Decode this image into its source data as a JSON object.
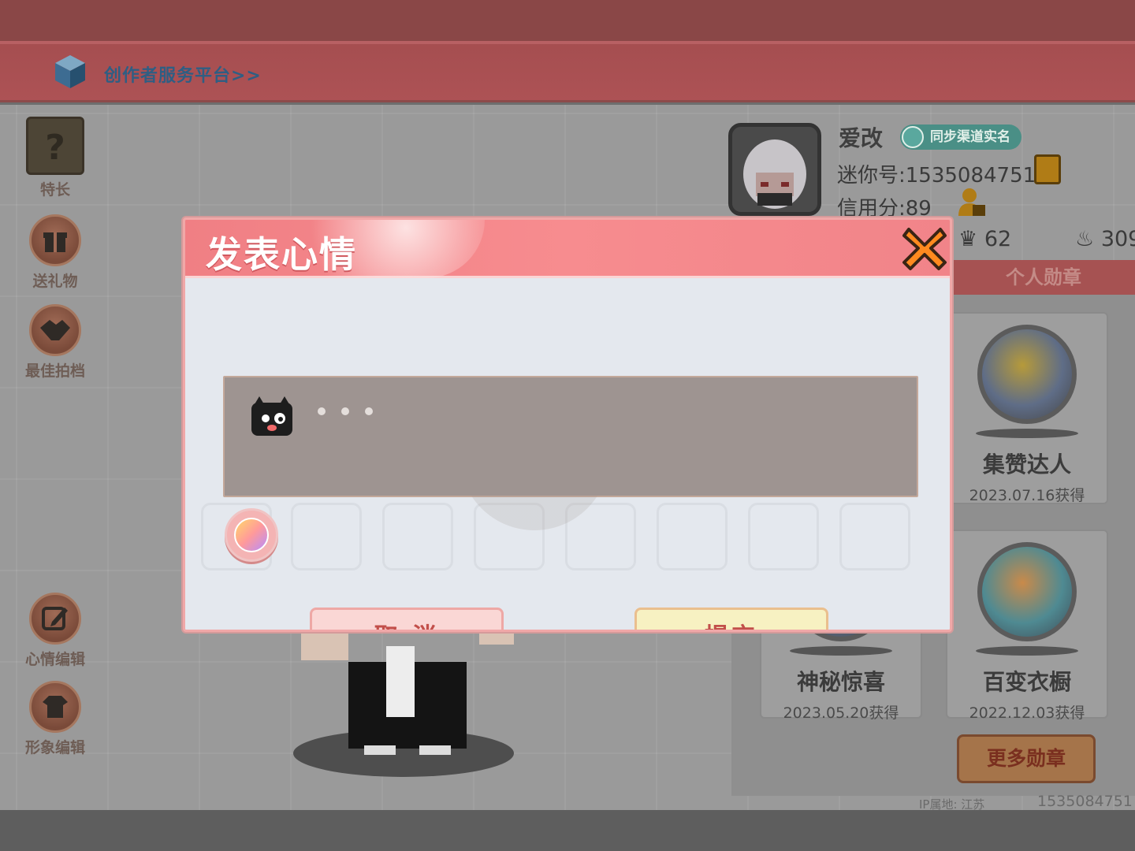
{
  "topbar": {
    "creator_link": "创作者服务平台>>"
  },
  "sidebar": {
    "items": [
      {
        "label": "特长",
        "icon": "question-block-icon"
      },
      {
        "label": "送礼物",
        "icon": "gift-icon"
      },
      {
        "label": "最佳拍档",
        "icon": "handshake-icon"
      },
      {
        "label": "心情编辑",
        "icon": "edit-icon"
      },
      {
        "label": "形象编辑",
        "icon": "outfit-icon"
      }
    ]
  },
  "profile": {
    "name": "爱改",
    "realname_badge": "同步渠道实名",
    "mini_id": "迷你号:1535084751",
    "credit": "信用分:89",
    "likes": "62",
    "hot": "309"
  },
  "medals": {
    "header": "个人勋章",
    "items": [
      {
        "name": "集赞达人",
        "date": "2023.07.16获得"
      },
      {
        "name": "神秘惊喜",
        "date": "2023.05.20获得"
      },
      {
        "name": "百变衣橱",
        "date": "2022.12.03获得"
      }
    ],
    "more_button": "更多勋章"
  },
  "footer": {
    "ip_location": "IP属地: 江苏",
    "uid": "1535084751"
  },
  "modal": {
    "title": "发表心情",
    "cancel_label": "取 消",
    "submit_label": "提交"
  },
  "colors": {
    "modal_header": "#f07f84",
    "cancel_bg": "#fad7d5",
    "submit_bg": "#f7f1c2",
    "button_text": "#c24f4a"
  }
}
